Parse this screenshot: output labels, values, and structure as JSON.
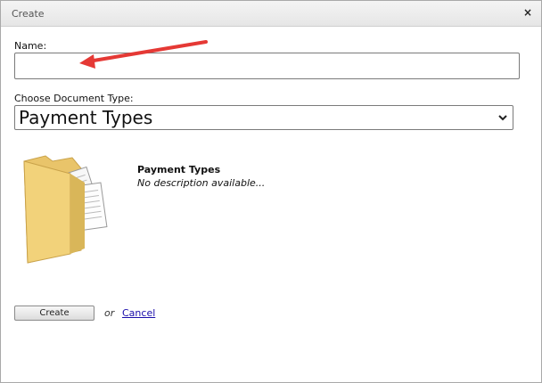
{
  "dialog": {
    "title": "Create",
    "close_symbol": "×"
  },
  "form": {
    "name_label": "Name:",
    "name_value": "",
    "doctype_label": "Choose Document Type:",
    "doctype_selected": "Payment Types"
  },
  "preview": {
    "title": "Payment Types",
    "description": "No description available...",
    "icon": "folder-icon"
  },
  "actions": {
    "create_label": "Create",
    "or_text": "or",
    "cancel_label": "Cancel"
  },
  "colors": {
    "arrow": "#e53935",
    "link": "#1a0dab"
  }
}
